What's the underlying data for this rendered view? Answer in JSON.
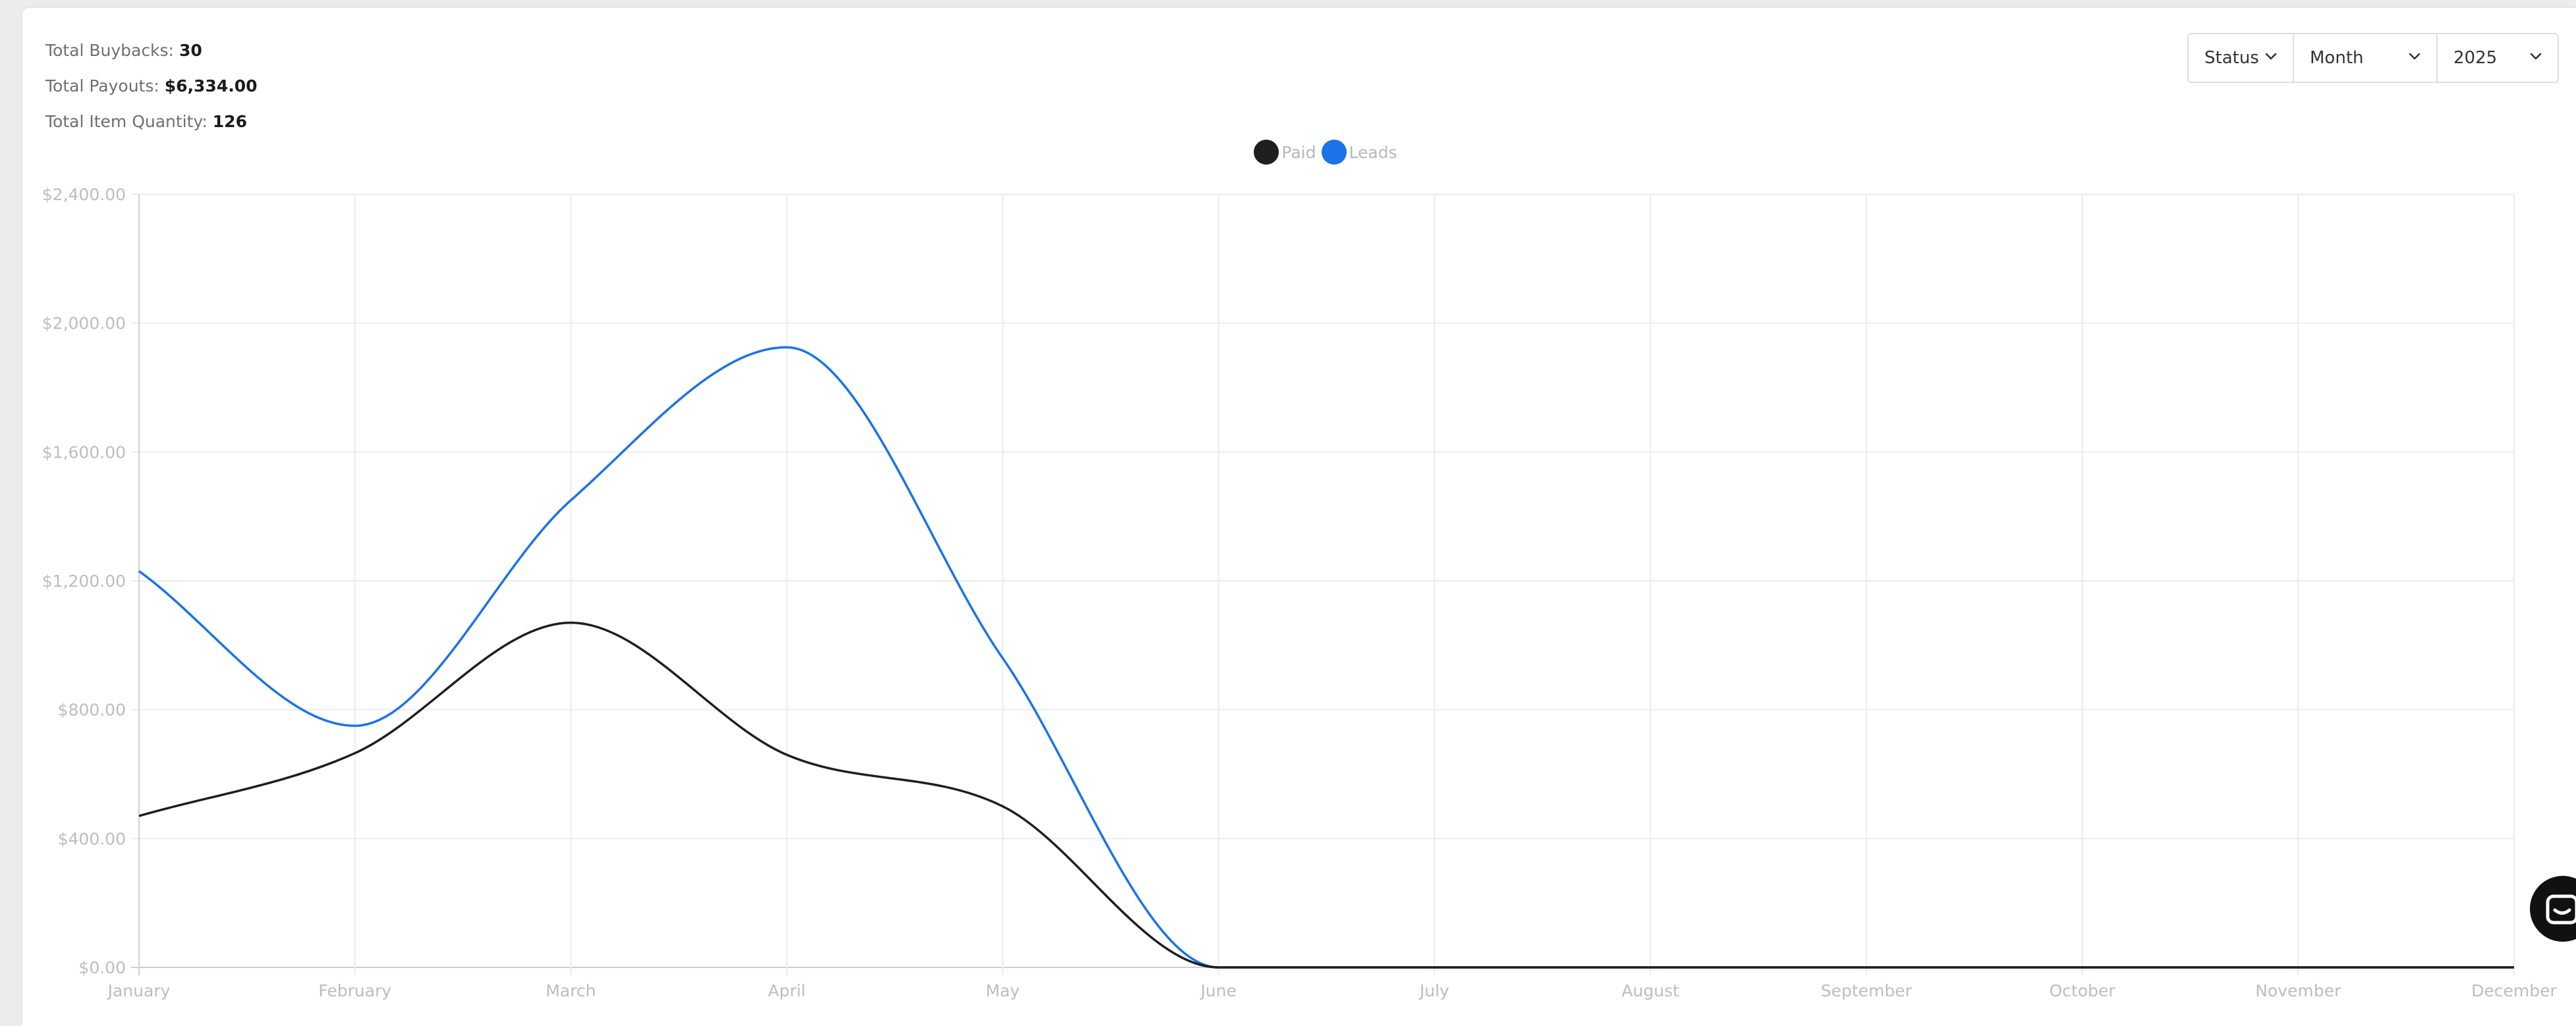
{
  "summary": {
    "buybacks_label": "Total Buybacks:",
    "buybacks_value": "30",
    "payouts_label": "Total Payouts:",
    "payouts_value": "$6,334.00",
    "quantity_label": "Total Item Quantity:",
    "quantity_value": "126"
  },
  "filters": {
    "status": "Status",
    "period": "Month",
    "year": "2025"
  },
  "chart_data": {
    "type": "line",
    "categories": [
      "January",
      "February",
      "March",
      "April",
      "May",
      "June",
      "July",
      "August",
      "September",
      "October",
      "November",
      "December"
    ],
    "series": [
      {
        "name": "Paid",
        "color": "#1f1f1f",
        "values": [
          470,
          665,
          1070,
          660,
          500,
          0,
          0,
          0,
          0,
          0,
          0,
          0
        ]
      },
      {
        "name": "Leads",
        "color": "#1a73e8",
        "values": [
          1230,
          750,
          1450,
          1925,
          960,
          0,
          0,
          0,
          0,
          0,
          0,
          0
        ]
      }
    ],
    "ylim": [
      0,
      2400
    ],
    "yticks": [
      "$0.00",
      "$400.00",
      "$800.00",
      "$1,200.00",
      "$1,600.00",
      "$2,000.00",
      "$2,400.00"
    ],
    "grid": true,
    "legend": "top-center"
  }
}
